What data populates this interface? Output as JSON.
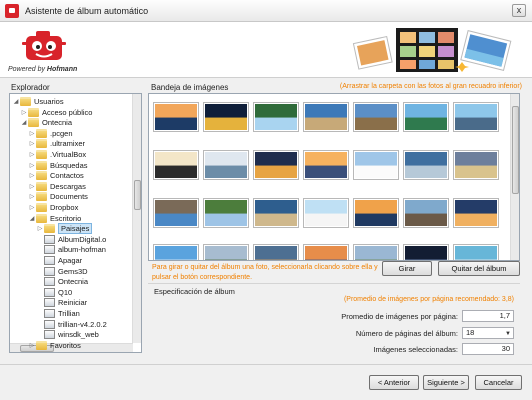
{
  "window": {
    "title": "Asistente de álbum automático",
    "close_label": "x"
  },
  "header": {
    "powered_prefix": "Powered by",
    "powered_brand": "Hofmann"
  },
  "explorer": {
    "label": "Explorador",
    "rows": [
      {
        "label": "Usuarios",
        "type": "folder",
        "twisty": "◢",
        "indent": 1
      },
      {
        "label": "Acceso público",
        "type": "folder",
        "twisty": "▷",
        "indent": 2
      },
      {
        "label": "Ontecnia",
        "type": "folder",
        "twisty": "◢",
        "indent": 2
      },
      {
        "label": ".pcgen",
        "type": "folder",
        "twisty": "▷",
        "indent": 3
      },
      {
        "label": ".ultramixer",
        "type": "folder",
        "twisty": "▷",
        "indent": 3
      },
      {
        "label": ".VirtualBox",
        "type": "folder",
        "twisty": "▷",
        "indent": 3
      },
      {
        "label": "Búsquedas",
        "type": "folder",
        "twisty": "▷",
        "indent": 3
      },
      {
        "label": "Contactos",
        "type": "folder",
        "twisty": "▷",
        "indent": 3
      },
      {
        "label": "Descargas",
        "type": "folder",
        "twisty": "▷",
        "indent": 3
      },
      {
        "label": "Documents",
        "type": "folder",
        "twisty": "▷",
        "indent": 3
      },
      {
        "label": "Dropbox",
        "type": "folder",
        "twisty": "▷",
        "indent": 3
      },
      {
        "label": "Escritorio",
        "type": "folder",
        "twisty": "◢",
        "indent": 3
      },
      {
        "label": "Paisajes",
        "type": "folder",
        "twisty": "▷",
        "indent": 4,
        "selected": true
      },
      {
        "label": "AlbumDigital.o",
        "type": "app",
        "twisty": "",
        "indent": 4
      },
      {
        "label": "album-hofman",
        "type": "app",
        "twisty": "",
        "indent": 4
      },
      {
        "label": "Apagar",
        "type": "app",
        "twisty": "",
        "indent": 4
      },
      {
        "label": "Gems3D",
        "type": "app",
        "twisty": "",
        "indent": 4
      },
      {
        "label": "Ontecnia",
        "type": "app",
        "twisty": "",
        "indent": 4
      },
      {
        "label": "Q10",
        "type": "app",
        "twisty": "",
        "indent": 4
      },
      {
        "label": "Reiniciar",
        "type": "app",
        "twisty": "",
        "indent": 4
      },
      {
        "label": "Trillian",
        "type": "app",
        "twisty": "",
        "indent": 4
      },
      {
        "label": "trillian-v4.2.0.2",
        "type": "app",
        "twisty": "",
        "indent": 4
      },
      {
        "label": "winsdk_web",
        "type": "app",
        "twisty": "",
        "indent": 4
      },
      {
        "label": "Favoritos",
        "type": "folder",
        "twisty": "▷",
        "indent": 3
      }
    ]
  },
  "tray": {
    "label": "Bandeja de imágenes",
    "hint": "(Arrastrar la carpeta con las fotos al gran recuadro inferior)",
    "thumbnails": [
      "sea-sunset",
      "night-city",
      "waterfall",
      "coast-rocks",
      "coast-cliff",
      "island",
      "mountain-lake",
      "dark-tree",
      "winter-field",
      "pier-lights",
      "sunset-shore",
      "cloud-sky",
      "mountain-bay",
      "city-river",
      "rocky-shore",
      "mountain-stream",
      "sea-cliff",
      "white-cliffs",
      "lighthouse",
      "harbor",
      "dusk-lake",
      "sky-blue",
      "coast-road",
      "rock-arch",
      "sunset-clouds",
      "hills",
      "night-sky",
      "lagoon"
    ]
  },
  "actions": {
    "rotate_hint": "Para girar o quitar del álbum una foto, seleccionarla clicando sobre ella y pulsar el botón correspondiente.",
    "rotate_label": "Girar",
    "remove_label": "Quitar del álbum"
  },
  "spec": {
    "title": "Especificación de álbum",
    "hint": "(Promedio de imágenes por página recomendado: 3,8)",
    "avg_label": "Promedio de imágenes por página:",
    "avg_value": "1,7",
    "pages_label": "Número de páginas del álbum:",
    "pages_value": "18",
    "selected_label": "Imágenes seleccionadas:",
    "selected_value": "30"
  },
  "footer": {
    "back_label": "< Anterior",
    "next_label": "Siguiente >",
    "cancel_label": "Cancelar"
  },
  "colors": {
    "accent_orange": "#f08000",
    "brand_red": "#d8232a",
    "selection_blue": "#cce4f7"
  }
}
